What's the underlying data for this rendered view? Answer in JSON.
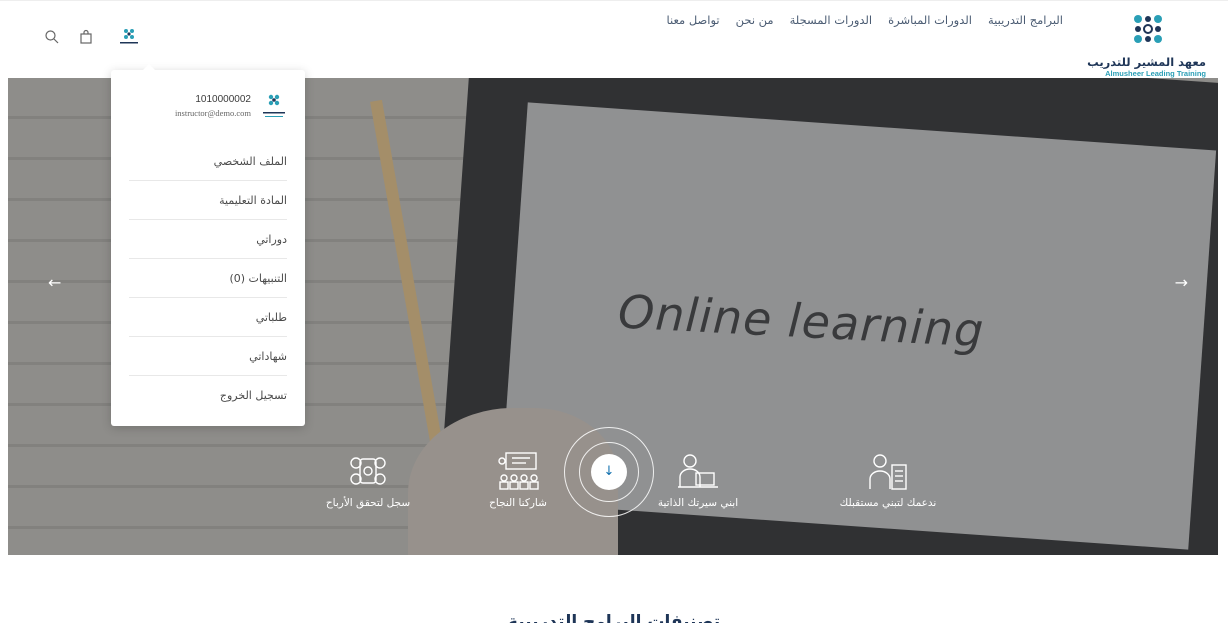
{
  "brand": {
    "name_ar": "معهد المشير للتدريب",
    "name_en": "Almusheer Leading Training",
    "primary_color": "#1e3557",
    "accent_color": "#2a9fb6"
  },
  "nav": {
    "items": [
      {
        "label": "البرامج التدريبية"
      },
      {
        "label": "الدورات المباشرة"
      },
      {
        "label": "الدورات المسجلة"
      },
      {
        "label": "من نحن"
      },
      {
        "label": "تواصل معنا"
      }
    ]
  },
  "header_icons": {
    "search": "search-icon",
    "bag": "shopping-bag-icon",
    "avatar": "user-avatar-logo"
  },
  "user_menu": {
    "phone": "1010000002",
    "email": "instructor@demo.com",
    "items": [
      {
        "label": "الملف الشخصي"
      },
      {
        "label": "المادة التعليمية"
      },
      {
        "label": "دوراتي"
      },
      {
        "label": "التنبيهات (0)"
      },
      {
        "label": "طلباتي"
      },
      {
        "label": "شهاداتي"
      },
      {
        "label": "تسجيل الخروج"
      }
    ]
  },
  "hero": {
    "image_text": "Online learning",
    "prev_arrow": "←",
    "next_arrow": "→",
    "scroll_arrow": "↓",
    "features": [
      {
        "label": "سجل لتحقق الأرباح",
        "icon": "social-media-icon"
      },
      {
        "label": "شاركنا النجاح",
        "icon": "presentation-audience-icon"
      },
      {
        "label": "ابني سيرتك الذاتية",
        "icon": "person-laptop-icon"
      },
      {
        "label": "ندعمك لتبني مستقبلك",
        "icon": "person-document-icon"
      }
    ]
  },
  "section": {
    "title": "تصنيفات البرامج التدريبية"
  }
}
